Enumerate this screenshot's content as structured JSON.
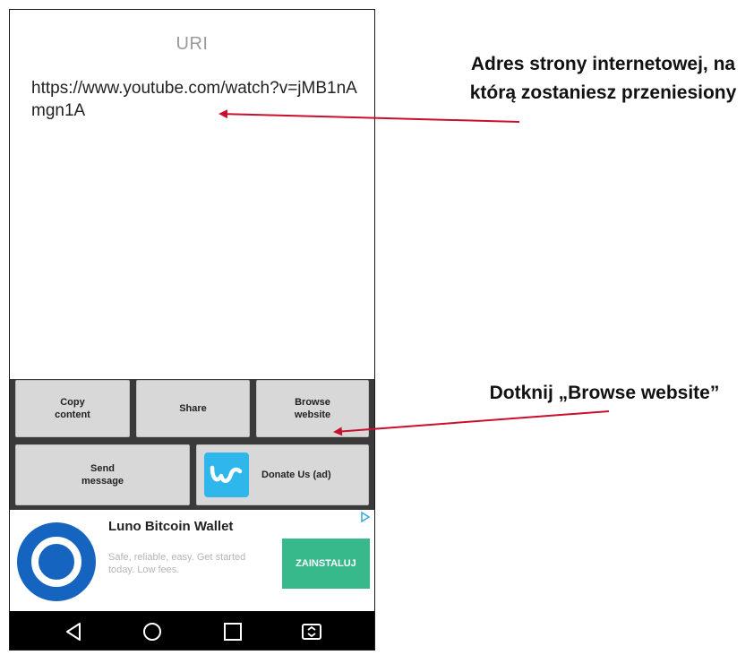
{
  "uri_screen": {
    "title": "URI",
    "value": "https://www.youtube.com/watch?v=jMB1nAmgn1A"
  },
  "buttons": {
    "copy_content": "Copy\ncontent",
    "share": "Share",
    "browse_website": "Browse\nwebsite",
    "send_message": "Send\nmessage",
    "donate": "Donate Us (ad)"
  },
  "ad": {
    "title": "Luno Bitcoin Wallet",
    "description": "Safe, reliable, easy. Get started today. Low fees.",
    "install_label": "ZAINSTALUJ"
  },
  "annotations": {
    "address": "Adres strony internetowej, na którą zostaniesz przeniesiony",
    "browse": "Dotknij „Browse website”"
  },
  "colors": {
    "arrow": "#c8102e",
    "button_bg": "#d8d8d8",
    "button_area": "#3a3a3a",
    "install": "#37b98c",
    "wish": "#2fb7ec",
    "luno": "#1565c0"
  },
  "icons": [
    "back-icon",
    "home-icon",
    "recents-icon",
    "screen-mirror-icon",
    "wish-logo-icon",
    "luno-logo-icon",
    "ad-choices-icon"
  ]
}
